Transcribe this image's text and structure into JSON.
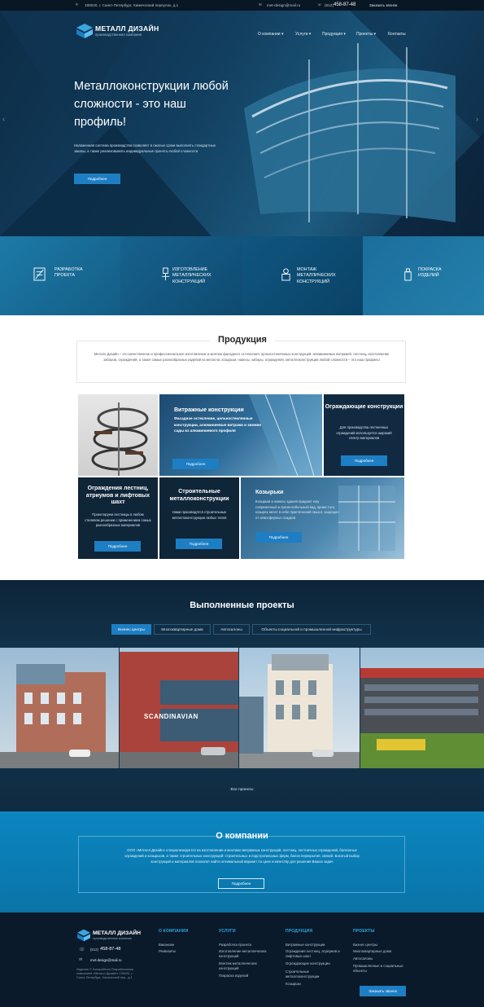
{
  "topbar": {
    "address": "190020, г. Санкт-Петербург, Химический переулок, д.1",
    "email": "met-design@mail.ru",
    "phone_prefix": "(812)",
    "phone": "458-87-48",
    "callback": "Заказать звонок"
  },
  "brand": {
    "name": "МЕТАЛЛ ДИЗАЙН",
    "tagline": "производственная компания"
  },
  "nav": [
    "О компании",
    "Услуги",
    "Продукция",
    "Проекты",
    "Контакты"
  ],
  "hero": {
    "title": "Металлоконструкции любой сложности - это наш профиль!",
    "desc": "Налаженная система производства позволяет в сжатые сроки выполнять стандартные заказы, а также реализовывать индивидуальные проекты любой сложности",
    "button": "Подробнее"
  },
  "services": [
    "РАЗРАБОТКА ПРОЕКТА",
    "ИЗГОТОВЛЕНИЕ МЕТАЛЛИЧЕСКИХ КОНСТРУКЦИЙ",
    "МОНТАЖ МЕТАЛЛИЧЕСКИХ КОНСТРУКЦИЙ",
    "ПОКРАСКА ИЗДЕЛИЙ"
  ],
  "products": {
    "title": "Продукция",
    "desc": "Металл Дизайн – это качественное и профессиональное изготовление и монтаж фасадного остекления, цельностеклянных конструкций, алюминиевых витражей, лестниц, изготовление заборов, ограждений, а также самых разнообразных изделий из металла: козырьки, навесы, заборы, ограждения, металлоконструкции любой сложности – это наш профиль!",
    "cards": [
      {
        "title": "Витражные конструкции",
        "desc": "Фасадное остекление, цельностеклянные конструкции, алюминиевые витражи и зимние сады из алюминиевого профиля",
        "button": "Подробнее"
      },
      {
        "title": "Ограждающие конструкции",
        "desc": "Для производства лестничных ограждений используется широкий спектр материалов",
        "button": "Подробнее"
      },
      {
        "title": "Ограждения лестниц, атриумов и лифтовых шахт",
        "desc": "Проектируем лестницы в любом стилевом решении с применением самых разнообразных материалов",
        "button": "Подробнее"
      },
      {
        "title": "Строительные металлоконструкции",
        "desc": "Нами производятся строительные металлоконструкции любых типов",
        "button": "Подробнее"
      },
      {
        "title": "Козырьки",
        "desc": "Козырьки и навесы здания придают ему современный и презентабельный вид, кроме того, козырек несет в себе практический смысл, защищая от атмосферных осадков",
        "button": "Подробнее"
      }
    ]
  },
  "projects": {
    "title": "Выполненные проекты",
    "tabs": [
      "Бизнес центры",
      "Многоквартирные дома",
      "Автосалоны",
      "Объекты социальной и промышленной инфраструктуры"
    ],
    "signs": [
      "SCANDINAVIAN"
    ],
    "all": "Все проекты"
  },
  "about": {
    "title": "О компании",
    "desc": "ООО «Металл Дизайн» специализируется на изготовлении и монтаже витражных конструкций, лестниц, лестничных ограждений, балконных ограждений и козырьков, а также строительных конструкций: строительных и подстропильных ферм, балок перекрытия, связей. Богатый выбор конструкций и материалов позволит найти оптимальный вариант по цене и качеству для решения Ваших задач",
    "button": "Подробнее"
  },
  "footer": {
    "phone_prefix": "(812)",
    "phone": "458-87-48",
    "email": "met-design@mail.ru",
    "copyright": "Изделия © Копирайтинг Разработанная компанией «Металл Дизайн» 190020, г. Санкт-Петербург, Химический пер., д.1",
    "cols": [
      {
        "head": "О КОМПАНИИ",
        "items": [
          "Вакансии",
          "Реквизиты"
        ]
      },
      {
        "head": "УСЛУГИ",
        "items": [
          "Разработка проекта",
          "Изготовление металлических конструкций",
          "Монтаж металлических конструкций",
          "Покраска изделий"
        ]
      },
      {
        "head": "ПРОДУКЦИЯ",
        "items": [
          "Витражные конструкции",
          "Ограждения лестниц, атриумов и лифтовых шахт",
          "Ограждающие конструкции",
          "Строительные металлоконструкции",
          "Козырьки"
        ]
      },
      {
        "head": "ПРОЕКТЫ",
        "items": [
          "Бизнес центры",
          "Многоквартирные дома",
          "Автосалоны",
          "Промышленные и социальные объекты"
        ]
      }
    ],
    "callback": "Заказать звонок"
  },
  "colors": {
    "accent": "#1e7ec3",
    "footer_heading": "#2ea7e6",
    "dark": "#0a1a2b",
    "about_bg": "#0b86c0"
  },
  "icons": [
    "map-pin-icon",
    "mail-icon",
    "phone-icon",
    "logo-cube-icon",
    "arrow-left-icon",
    "arrow-right-icon",
    "blueprint-icon",
    "welding-icon",
    "installer-icon",
    "spray-can-icon"
  ]
}
